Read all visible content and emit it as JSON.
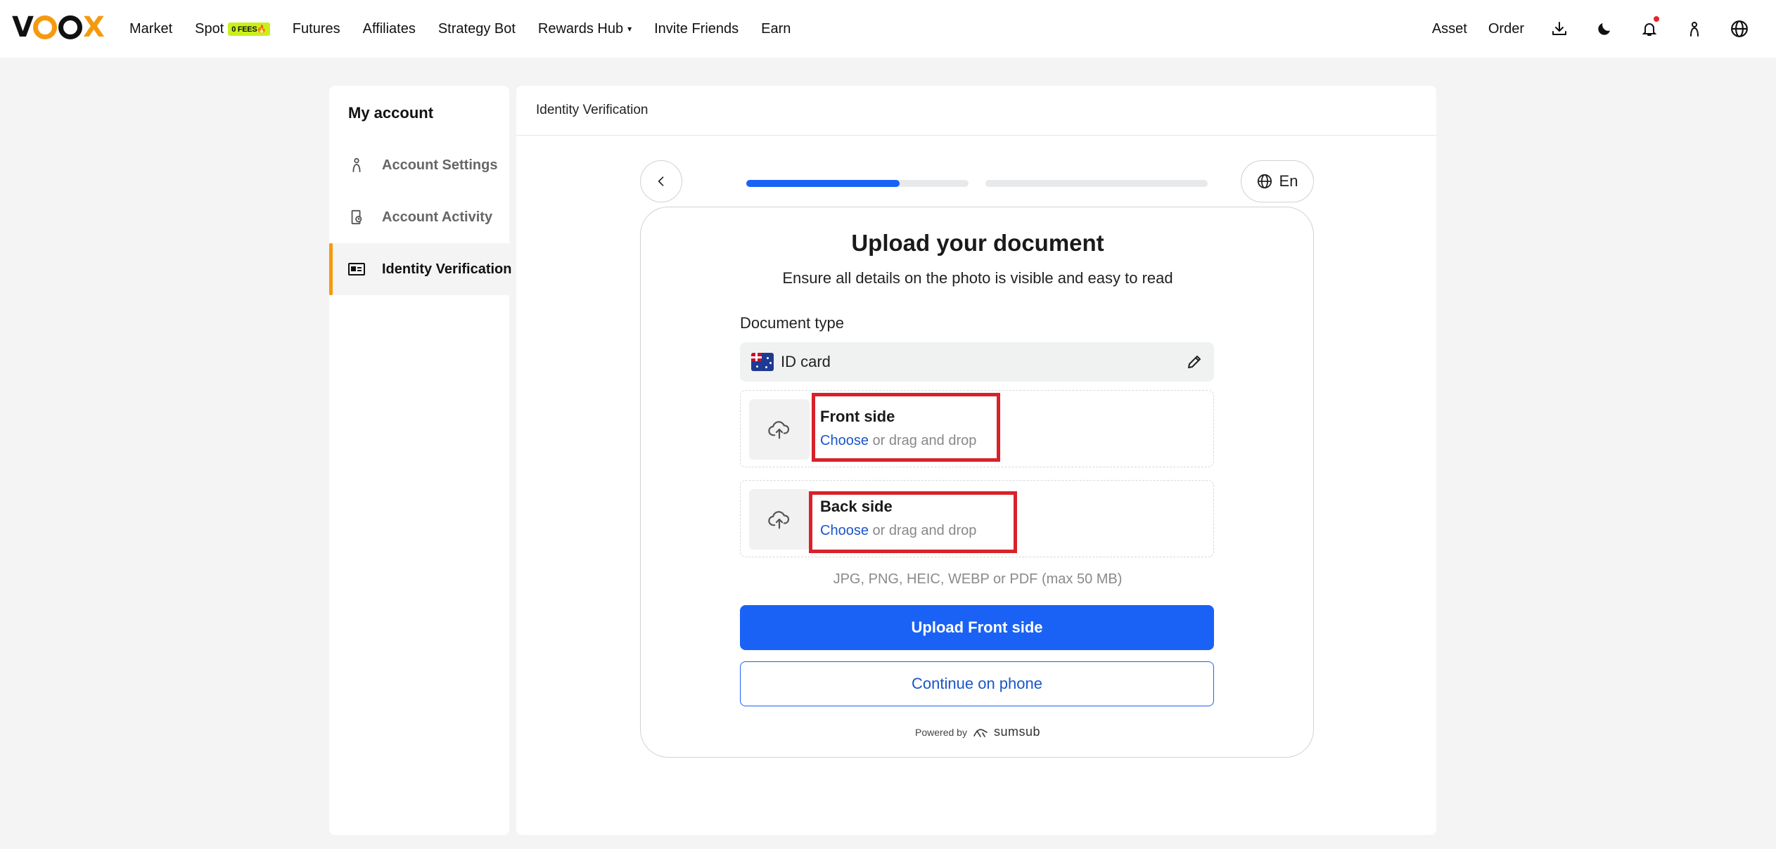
{
  "app": {
    "logo_text": "VOOX"
  },
  "nav": {
    "items": [
      {
        "label": "Market"
      },
      {
        "label": "Spot",
        "badge": "0 FEES🔥"
      },
      {
        "label": "Futures"
      },
      {
        "label": "Affiliates"
      },
      {
        "label": "Strategy Bot"
      },
      {
        "label": "Rewards Hub",
        "has_dropdown": true
      },
      {
        "label": "Invite Friends"
      },
      {
        "label": "Earn"
      }
    ],
    "right": {
      "asset_label": "Asset",
      "order_label": "Order",
      "icons": [
        "download-icon",
        "moon-icon",
        "bell-icon",
        "user-icon",
        "globe-icon"
      ],
      "notification_dot_color": "#e5262b"
    }
  },
  "sidebar": {
    "title": "My account",
    "items": [
      {
        "label": "Account Settings",
        "icon": "user-icon",
        "active": false
      },
      {
        "label": "Account Activity",
        "icon": "activity-icon",
        "active": false
      },
      {
        "label": "Identity Verification",
        "icon": "id-card-icon",
        "active": true
      }
    ],
    "accent_color": "#f59a10"
  },
  "main": {
    "header": "Identity Verification",
    "progress": {
      "steps": 2,
      "step1_fill_fraction": 0.69,
      "step2_fill_fraction": 0.0,
      "color": "#1a62f5"
    },
    "language_label": "En",
    "card": {
      "title": "Upload your document",
      "subtitle": "Ensure all details on the photo is visible and easy to read",
      "doc_type_label": "Document type",
      "doc_type_value": "ID card",
      "front": {
        "title": "Front side",
        "choose": "Choose",
        "rest": " or drag and drop"
      },
      "back": {
        "title": "Back side",
        "choose": "Choose",
        "rest": " or drag and drop"
      },
      "formats": "JPG, PNG, HEIC, WEBP or PDF (max 50 MB)",
      "primary_button": "Upload Front side",
      "secondary_button": "Continue on phone",
      "powered_by": "Powered by",
      "powered_brand": "sumsub"
    }
  }
}
